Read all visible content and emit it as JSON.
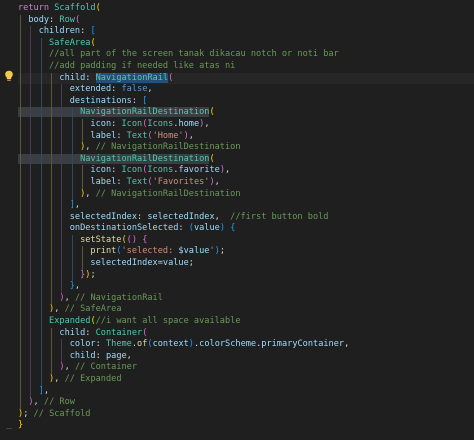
{
  "editor": {
    "colors": {
      "background": "#1f1f1f",
      "keyword": "#c586c0",
      "class": "#4ec9b0",
      "property": "#9cdcfe",
      "function": "#dcdcaa",
      "string": "#ce9178",
      "comment": "#6a9955",
      "boolean": "#569cd6",
      "bracket_gold": "#ffd700",
      "bracket_orchid": "#da70d6",
      "bracket_blue": "#179fff"
    },
    "lightbulb_icon": "lightbulb-icon",
    "lines": [
      [
        [
          "kw",
          "return "
        ],
        [
          "cls",
          "Scaffold"
        ],
        [
          "b1",
          "("
        ]
      ],
      [
        [
          "prop",
          "  body"
        ],
        [
          "pun",
          ": "
        ],
        [
          "cls",
          "Row"
        ],
        [
          "b2",
          "("
        ]
      ],
      [
        [
          "prop",
          "    children"
        ],
        [
          "pun",
          ": "
        ],
        [
          "b3",
          "["
        ]
      ],
      [
        [
          "cls",
          "      SafeArea"
        ],
        [
          "b1",
          "("
        ]
      ],
      [
        [
          "cmt",
          "      //all part of the screen tanak dikacau notch or noti bar"
        ]
      ],
      [
        [
          "cmt",
          "      //add padding if needed like atas ni"
        ]
      ],
      [
        [
          "prop",
          "        child"
        ],
        [
          "pun",
          ": "
        ],
        [
          "cls",
          "NavigationRail"
        ],
        [
          "b2",
          "("
        ]
      ],
      [
        [
          "prop",
          "          extended"
        ],
        [
          "pun",
          ": "
        ],
        [
          "bool",
          "false"
        ],
        [
          "pun",
          ","
        ]
      ],
      [
        [
          "prop",
          "          destinations"
        ],
        [
          "pun",
          ": "
        ],
        [
          "b3",
          "["
        ]
      ],
      [
        [
          "cls",
          "            NavigationRailDestination"
        ],
        [
          "b1",
          "("
        ]
      ],
      [
        [
          "prop",
          "              icon"
        ],
        [
          "pun",
          ": "
        ],
        [
          "cls",
          "Icon"
        ],
        [
          "b2",
          "("
        ],
        [
          "cls",
          "Icons"
        ],
        [
          "pun",
          "."
        ],
        [
          "prop",
          "home"
        ],
        [
          "b2",
          ")"
        ],
        [
          "pun",
          ","
        ]
      ],
      [
        [
          "prop",
          "              label"
        ],
        [
          "pun",
          ": "
        ],
        [
          "cls",
          "Text"
        ],
        [
          "b2",
          "("
        ],
        [
          "str",
          "'Home'"
        ],
        [
          "b2",
          ")"
        ],
        [
          "pun",
          ","
        ]
      ],
      [
        [
          "b1",
          "            )"
        ],
        [
          "pun",
          ", "
        ],
        [
          "cmt",
          "// NavigationRailDestination"
        ]
      ],
      [
        [
          "cls",
          "            NavigationRailDestination"
        ],
        [
          "b1",
          "("
        ]
      ],
      [
        [
          "prop",
          "              icon"
        ],
        [
          "pun",
          ": "
        ],
        [
          "cls",
          "Icon"
        ],
        [
          "b2",
          "("
        ],
        [
          "cls",
          "Icons"
        ],
        [
          "pun",
          "."
        ],
        [
          "prop",
          "favorite"
        ],
        [
          "b2",
          ")"
        ],
        [
          "pun",
          ","
        ]
      ],
      [
        [
          "prop",
          "              label"
        ],
        [
          "pun",
          ": "
        ],
        [
          "cls",
          "Text"
        ],
        [
          "b2",
          "("
        ],
        [
          "str",
          "'Favorites'"
        ],
        [
          "b2",
          ")"
        ],
        [
          "pun",
          ","
        ]
      ],
      [
        [
          "b1",
          "            )"
        ],
        [
          "pun",
          ", "
        ],
        [
          "cmt",
          "// NavigationRailDestination"
        ]
      ],
      [
        [
          "b3",
          "          ]"
        ],
        [
          "pun",
          ","
        ]
      ],
      [
        [
          "prop",
          "          selectedIndex"
        ],
        [
          "pun",
          ": "
        ],
        [
          "prop",
          "selectedIndex"
        ],
        [
          "pun",
          ",  "
        ],
        [
          "cmt",
          "//first button bold"
        ]
      ],
      [
        [
          "prop",
          "          onDestinationSelected"
        ],
        [
          "pun",
          ": "
        ],
        [
          "b3",
          "("
        ],
        [
          "prop",
          "value"
        ],
        [
          "b3",
          ")"
        ],
        [
          "pun",
          " "
        ],
        [
          "b3",
          "{"
        ]
      ],
      [
        [
          "fn",
          "            setState"
        ],
        [
          "b1",
          "("
        ],
        [
          "b2",
          "()"
        ],
        [
          "pun",
          " "
        ],
        [
          "b2",
          "{"
        ]
      ],
      [
        [
          "fn",
          "              print"
        ],
        [
          "b3",
          "("
        ],
        [
          "str",
          "'selected: "
        ],
        [
          "prop",
          "$value"
        ],
        [
          "str",
          "'"
        ],
        [
          "b3",
          ")"
        ],
        [
          "pun",
          ";"
        ]
      ],
      [
        [
          "prop",
          "              selectedIndex"
        ],
        [
          "pun",
          "="
        ],
        [
          "prop",
          "value"
        ],
        [
          "pun",
          ";"
        ]
      ],
      [
        [
          "b2",
          "            }"
        ],
        [
          "b1",
          ")"
        ],
        [
          "pun",
          ";"
        ]
      ],
      [
        [
          "b3",
          "          }"
        ],
        [
          "pun",
          ","
        ]
      ],
      [
        [
          "b2",
          "        )"
        ],
        [
          "pun",
          ", "
        ],
        [
          "cmt",
          "// NavigationRail"
        ]
      ],
      [
        [
          "b1",
          "      )"
        ],
        [
          "pun",
          ", "
        ],
        [
          "cmt",
          "// SafeArea"
        ]
      ],
      [
        [
          "cls",
          "      Expanded"
        ],
        [
          "b1",
          "("
        ],
        [
          "cmt",
          "//i want all space available"
        ]
      ],
      [
        [
          "prop",
          "        child"
        ],
        [
          "pun",
          ": "
        ],
        [
          "cls",
          "Container"
        ],
        [
          "b2",
          "("
        ]
      ],
      [
        [
          "prop",
          "          color"
        ],
        [
          "pun",
          ": "
        ],
        [
          "cls",
          "Theme"
        ],
        [
          "pun",
          "."
        ],
        [
          "fn",
          "of"
        ],
        [
          "b3",
          "("
        ],
        [
          "prop",
          "context"
        ],
        [
          "b3",
          ")"
        ],
        [
          "pun",
          "."
        ],
        [
          "prop",
          "colorScheme"
        ],
        [
          "pun",
          "."
        ],
        [
          "prop",
          "primaryContainer"
        ],
        [
          "pun",
          ","
        ]
      ],
      [
        [
          "prop",
          "          child"
        ],
        [
          "pun",
          ": "
        ],
        [
          "prop",
          "page"
        ],
        [
          "pun",
          ","
        ]
      ],
      [
        [
          "b2",
          "        )"
        ],
        [
          "pun",
          ", "
        ],
        [
          "cmt",
          "// Container"
        ]
      ],
      [
        [
          "b1",
          "      )"
        ],
        [
          "pun",
          ", "
        ],
        [
          "cmt",
          "// Expanded"
        ]
      ],
      [
        [
          "b3",
          "    ]"
        ],
        [
          "pun",
          ","
        ]
      ],
      [
        [
          "b2",
          "  )"
        ],
        [
          "pun",
          ", "
        ],
        [
          "cmt",
          "// Row"
        ]
      ],
      [
        [
          "b1",
          ")"
        ],
        [
          "pun",
          "; "
        ],
        [
          "cmt",
          "// Scaffold"
        ]
      ],
      [
        [
          "b1",
          "}"
        ]
      ]
    ]
  }
}
